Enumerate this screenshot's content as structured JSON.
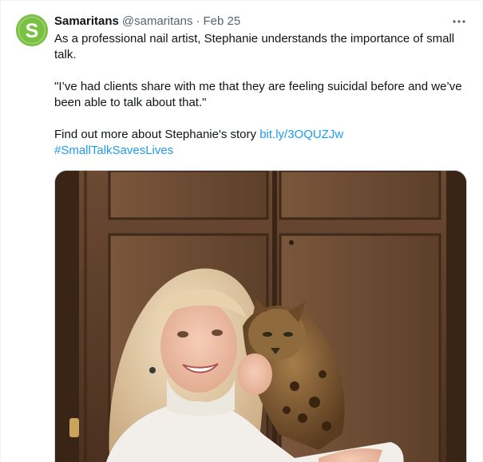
{
  "tweet": {
    "display_name": "Samaritans",
    "handle": "@samaritans",
    "separator": "·",
    "date": "Feb 25",
    "more_icon": "more-dots-icon",
    "avatar_icon": "samaritans-logo-icon",
    "text_line_1": "As a professional nail artist, Stephanie understands the importance of small talk.",
    "text_line_2": "\"I’ve had clients share with me that they are feeling suicidal before and we’ve been able to talk about that.\"",
    "text_line_3_prefix": "Find out more about Stephanie's story ",
    "link": "bit.ly/3OQUZJw",
    "hashtag": "#SmallTalkSavesLives",
    "link_color": "#1d9bf0",
    "brand_color": "#7ac143"
  }
}
